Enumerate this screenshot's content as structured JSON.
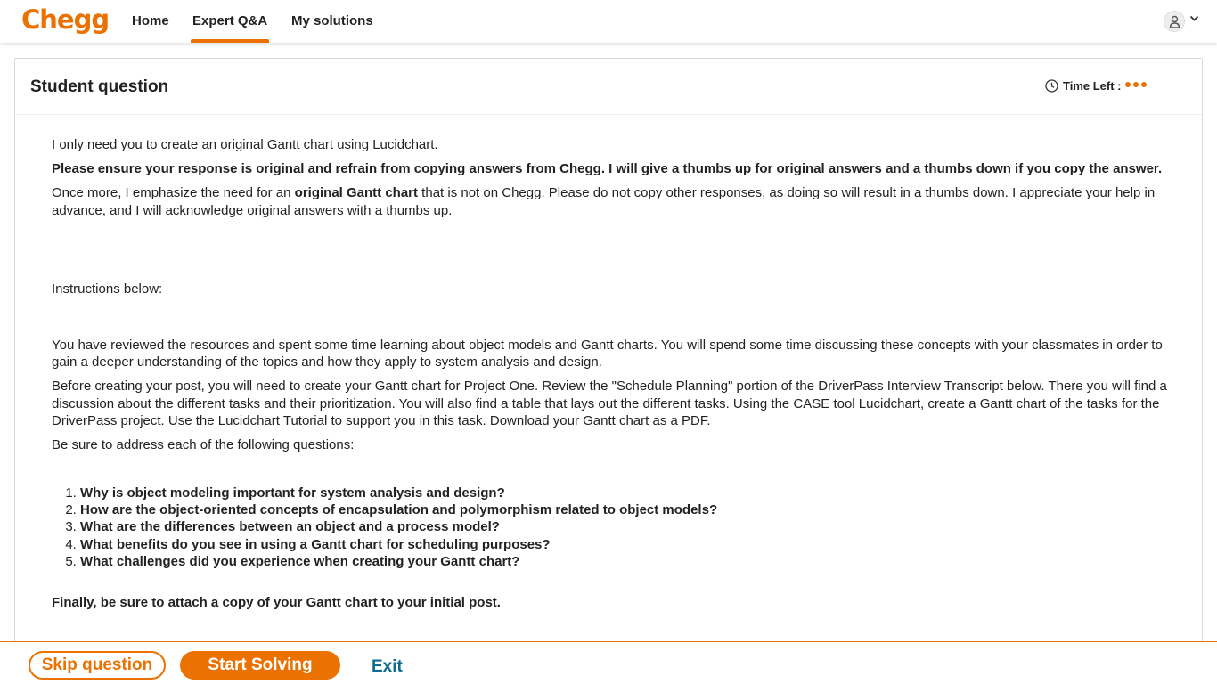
{
  "brand": {
    "logo_text": "Chegg",
    "accent": "#eb7100"
  },
  "nav": {
    "home": "Home",
    "expert_qa": "Expert Q&A",
    "my_solutions": "My solutions",
    "active_tab": "Expert Q&A"
  },
  "user_menu": {
    "icon": "user-icon",
    "dropdown_icon": "chevron-down-icon"
  },
  "card": {
    "title": "Student question",
    "timer_label": "Time Left :",
    "timer_icon": "clock-icon"
  },
  "question": {
    "p1": "I only need you to create an original Gantt chart using Lucidchart.",
    "p2": "Please ensure your response is original and refrain from copying answers from Chegg. I will give a thumbs up for original answers and a thumbs down if you copy the answer.",
    "p3_a": "Once more, I emphasize the need for an ",
    "p3_b": "original Gantt chart",
    "p3_c": " that is not on Chegg. Please do not copy other responses, as doing so will result in a thumbs down. I appreciate your help in advance, and I will acknowledge original answers with a thumbs up.",
    "p4": "Instructions below:",
    "p5": "You have reviewed the resources and spent some time learning about object models and Gantt charts. You will spend some time discussing these concepts with your classmates in order to gain a deeper understanding of the topics and how they apply to system analysis and design.",
    "p6": "Before creating your post, you will need to create your Gantt chart for Project One. Review the \"Schedule Planning\" portion of the DriverPass Interview Transcript below. There you will find a discussion about the different tasks and their prioritization. You will also find a table that lays out the different tasks. Using the CASE tool Lucidchart, create a Gantt chart of the tasks for the DriverPass project. Use the Lucidchart Tutorial to support you in this task. Download your Gantt chart as a PDF.",
    "p7": "Be sure to address each of the following questions:",
    "questions": [
      "Why is object modeling important for system analysis and design?",
      "How are the object-oriented concepts of encapsulation and polymorphism related to object models?",
      "What are the differences between an object and a process model?",
      "What benefits do you see in using a Gantt chart for scheduling purposes?",
      "What challenges did you experience when creating your Gantt chart?"
    ],
    "p8": "Finally, be sure to attach a copy of your Gantt chart to your initial post."
  },
  "actions": {
    "skip": "Skip question",
    "start": "Start Solving",
    "exit": "Exit"
  }
}
